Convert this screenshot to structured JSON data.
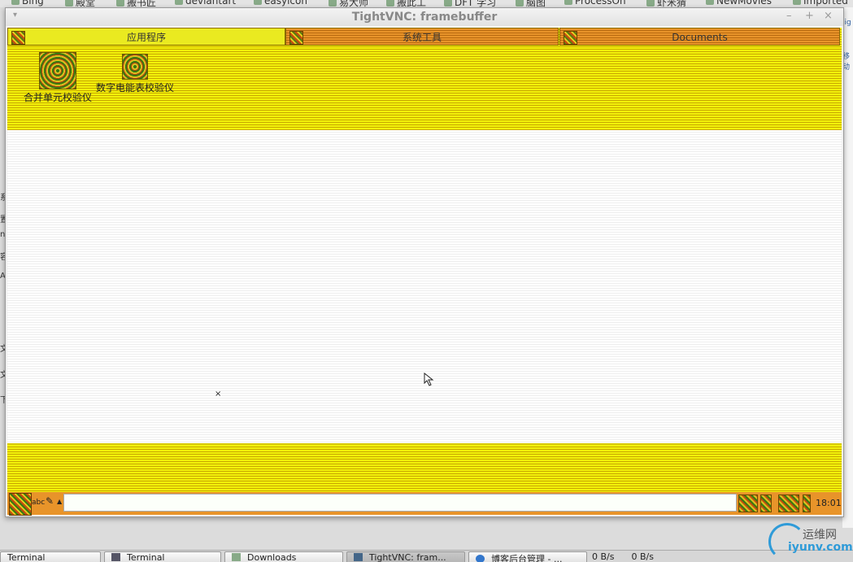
{
  "bookmarks": [
    "Bing",
    "殿堂",
    "搬书匠",
    "deviantart",
    "easyicon",
    "易大师",
    "搬此工",
    "DFT 学习",
    "脑图",
    "ProcessOn",
    "虾米猜",
    "NewMovies",
    "Imported"
  ],
  "host_right": [
    "lig",
    "移动"
  ],
  "host_left": [
    "系",
    "置",
    "n",
    "容",
    "A",
    "文",
    "文",
    "下"
  ],
  "window": {
    "title": "TightVNC: framebuffer",
    "menu_glyph": "▾",
    "minimize": "–",
    "maximize": "+",
    "close": "×"
  },
  "remote": {
    "tabs": [
      {
        "label": "应用程序",
        "icon": "app-folder-icon",
        "active": true
      },
      {
        "label": "系统工具",
        "icon": "tools-folder-icon",
        "active": false
      },
      {
        "label": "Documents",
        "icon": "documents-folder-icon",
        "active": false
      }
    ],
    "apps": [
      {
        "label": "合并单元校验仪",
        "icon": "calibrator-app-icon"
      },
      {
        "label": "数字电能表校验仪",
        "icon": "energy-meter-app-icon"
      }
    ],
    "cursor_glyph": "×",
    "taskbar": {
      "ime_label": "abc",
      "pencil": "✎",
      "arrow": "▲",
      "input_value": "",
      "clock": "18:01"
    }
  },
  "host_taskbar": {
    "items": [
      {
        "label": "Terminal",
        "active": false
      },
      {
        "label": "Terminal",
        "active": false
      },
      {
        "label": "Downloads",
        "active": false
      },
      {
        "label": "TightVNC: fram...",
        "active": true
      },
      {
        "label": "博客后台管理 - ...",
        "active": false
      }
    ],
    "net_down": "0 B/s",
    "net_up": "0 B/s"
  },
  "watermark": {
    "line1": "运维网",
    "line2": "iyunv.com"
  },
  "colors": {
    "accent_yellow": "#f2f20a",
    "accent_orange": "#e8942a",
    "watermark_blue": "#2f9bd8"
  }
}
